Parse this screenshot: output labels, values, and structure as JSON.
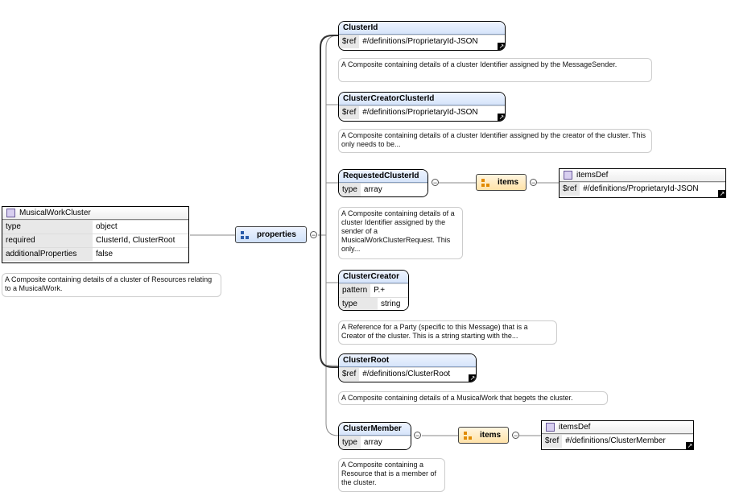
{
  "root": {
    "title": "MusicalWorkCluster",
    "rows": [
      {
        "key": "type",
        "value": "object"
      },
      {
        "key": "required",
        "value": "ClusterId, ClusterRoot"
      },
      {
        "key": "additionalProperties",
        "value": "false"
      }
    ],
    "doc": "A Composite containing details of a cluster of Resources relating to a MusicalWork."
  },
  "properties_label": "properties",
  "nodes": {
    "cluster_id": {
      "title": "ClusterId",
      "ref_key": "$ref",
      "ref_value": "#/definitions/ProprietaryId-JSON",
      "doc": "A Composite containing details of a cluster Identifier assigned by the MessageSender."
    },
    "cluster_creator_cluster_id": {
      "title": "ClusterCreatorClusterId",
      "ref_key": "$ref",
      "ref_value": "#/definitions/ProprietaryId-JSON",
      "doc": "A Composite containing details of a cluster Identifier assigned by the creator of the cluster. This only needs to be..."
    },
    "requested_cluster_id": {
      "title": "RequestedClusterId",
      "type_key": "type",
      "type_value": "array",
      "doc": "A Composite containing details of a cluster Identifier assigned by the sender of a MusicalWorkClusterRequest. This only...",
      "items_label": "items",
      "items_def": {
        "title": "itemsDef",
        "ref_key": "$ref",
        "ref_value": "#/definitions/ProprietaryId-JSON"
      }
    },
    "cluster_creator": {
      "title": "ClusterCreator",
      "pattern_key": "pattern",
      "pattern_value": "P.+",
      "type_key": "type",
      "type_value": "string",
      "doc": "A Reference for a Party (specific to this Message) that is a Creator of the cluster. This is a string starting with the..."
    },
    "cluster_root": {
      "title": "ClusterRoot",
      "ref_key": "$ref",
      "ref_value": "#/definitions/ClusterRoot",
      "doc": "A Composite containing details of a MusicalWork that begets the cluster."
    },
    "cluster_member": {
      "title": "ClusterMember",
      "type_key": "type",
      "type_value": "array",
      "doc": "A Composite containing a Resource that is a member of the cluster.",
      "items_label": "items",
      "items_def": {
        "title": "itemsDef",
        "ref_key": "$ref",
        "ref_value": "#/definitions/ClusterMember"
      }
    }
  }
}
